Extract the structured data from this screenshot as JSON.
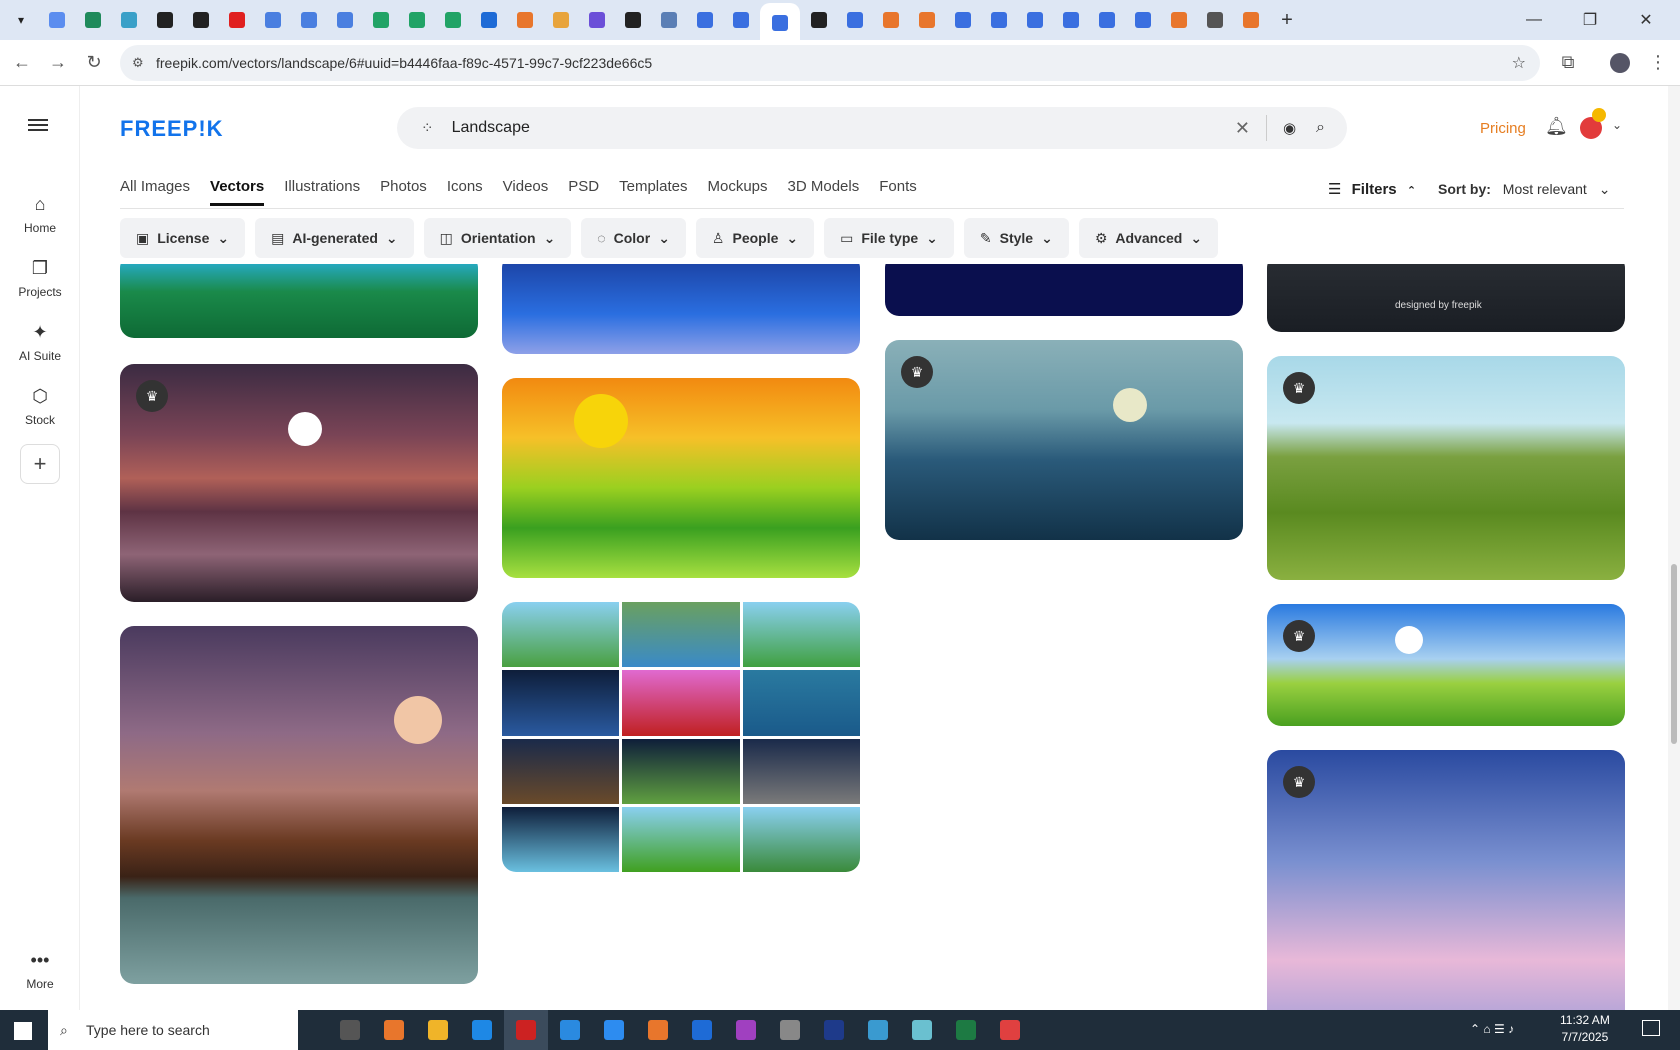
{
  "browser": {
    "url": "freepik.com/vectors/landscape/6#uuid=b4446faa-f89c-4571-99c7-9cf223de66c5",
    "tab_colors": [
      "#5b8def",
      "#1f8a5b",
      "#3aa0c8",
      "#222",
      "#222",
      "#e02020",
      "#4a7fe0",
      "#4a7fe0",
      "#4a7fe0",
      "#21a366",
      "#21a366",
      "#21a366",
      "#1e6bd6",
      "#e8762c",
      "#e8a43c",
      "#6b4fd8",
      "#222",
      "#5b7fb5",
      "#3a6fe0",
      "#3a6fe0",
      "#3a6fe0",
      "#222",
      "#3a6fe0",
      "#e8762c",
      "#e8762c",
      "#3a6fe0",
      "#3a6fe0",
      "#3a6fe0",
      "#3a6fe0",
      "#3a6fe0",
      "#3a6fe0",
      "#e8762c",
      "#555",
      "#e8762c"
    ]
  },
  "sidebar": {
    "items": [
      {
        "label": "Home",
        "icon": "home-icon"
      },
      {
        "label": "Projects",
        "icon": "projects-icon"
      },
      {
        "label": "AI Suite",
        "icon": "sparkle-icon"
      },
      {
        "label": "Stock",
        "icon": "stock-icon"
      }
    ],
    "more_label": "More"
  },
  "header": {
    "logo": "FREEP!K",
    "search_value": "Landscape",
    "pricing": "Pricing",
    "accent": "#1273eb"
  },
  "categories": [
    "All Images",
    "Vectors",
    "Illustrations",
    "Photos",
    "Icons",
    "Videos",
    "PSD",
    "Templates",
    "Mockups",
    "3D Models",
    "Fonts"
  ],
  "active_category": "Vectors",
  "sort": {
    "filters_label": "Filters",
    "sort_label": "Sort by:",
    "sort_value": "Most relevant"
  },
  "filters": [
    "License",
    "AI-generated",
    "Orientation",
    "Color",
    "People",
    "File type",
    "Style",
    "Advanced"
  ],
  "watermark": "designed by freepik",
  "taskbar": {
    "search_placeholder": "Type here to search",
    "time": "11:32 AM",
    "date": "7/7/2025"
  }
}
